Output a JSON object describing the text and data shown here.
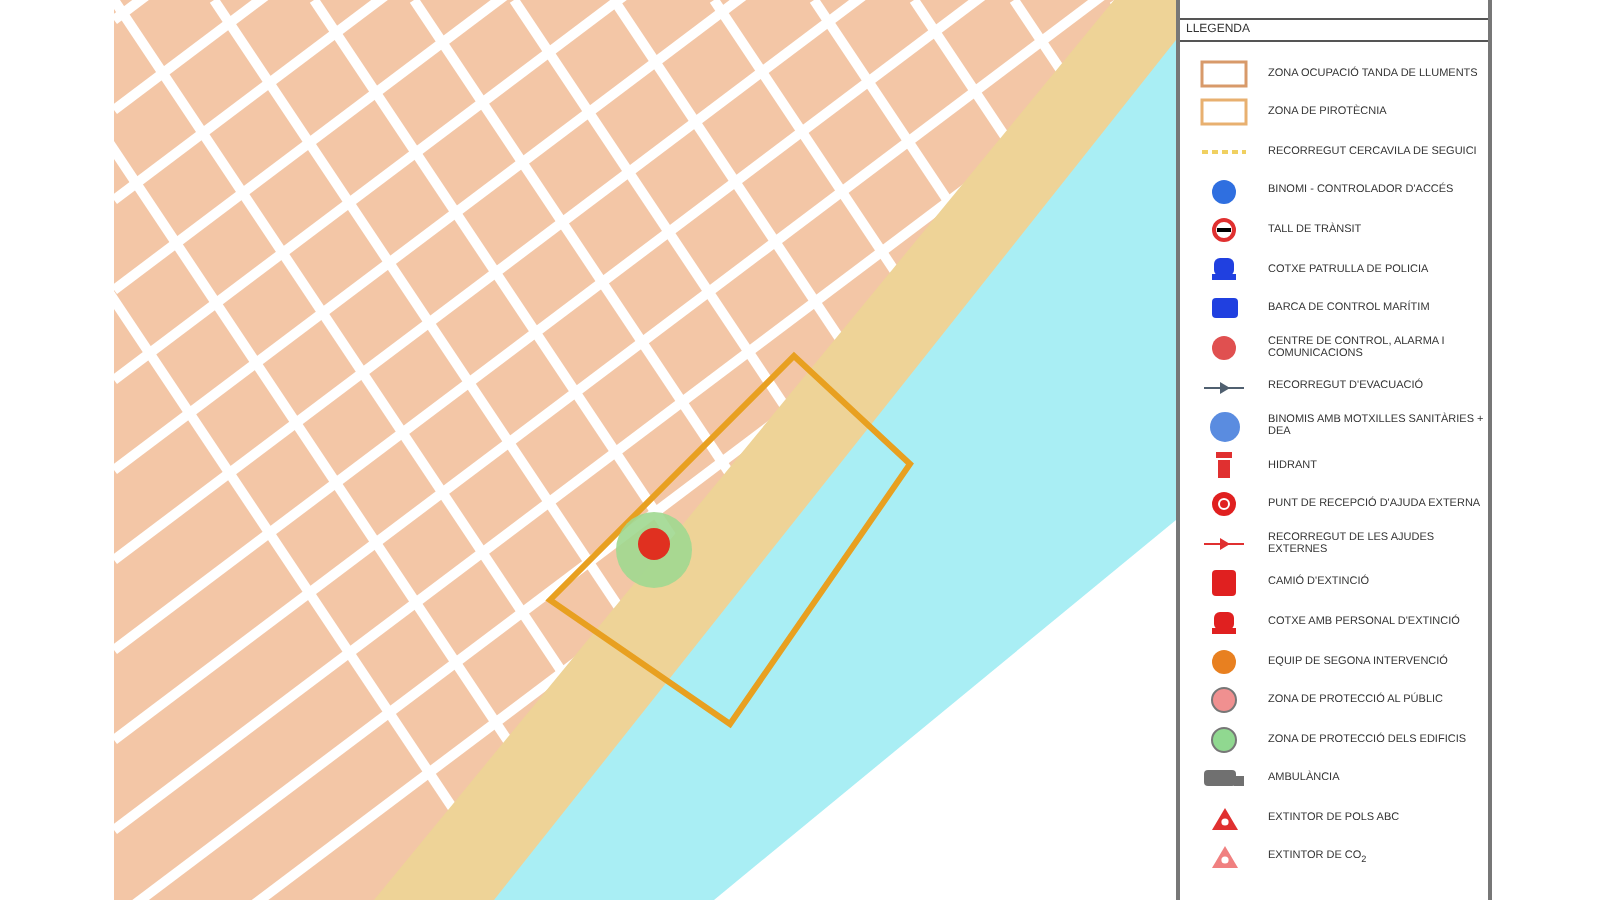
{
  "legend": {
    "title": "LLEGENDA",
    "items": [
      {
        "kind": "zone-rect",
        "color": "#d89a6a",
        "label": "ZONA OCUPACIÓ TANDA DE LLUMENTS"
      },
      {
        "kind": "zone-rect",
        "color": "#e8b070",
        "label": "ZONA DE PIROTÈCNIA"
      },
      {
        "kind": "dashed-line",
        "color": "#f0d060",
        "label": "RECORREGUT CERCAVILA DE SEGUICI"
      },
      {
        "kind": "circle",
        "color": "#2f6fe0",
        "label": "BINOMI - CONTROLADOR D'ACCÉS"
      },
      {
        "kind": "no-entry",
        "color": "#e03030",
        "label": "TALL DE TRÀNSIT"
      },
      {
        "kind": "car",
        "color": "#2040e0",
        "label": "COTXE PATRULLA DE POLICIA"
      },
      {
        "kind": "boat",
        "color": "#2040e0",
        "label": "BARCA DE CONTROL MARÍTIM"
      },
      {
        "kind": "circle",
        "color": "#e05050",
        "label": "CENTRE DE CONTROL, ALARMA I COMUNICACIONS"
      },
      {
        "kind": "arrow-line",
        "color": "#506070",
        "label": "RECORREGUT D'EVACUACIÓ"
      },
      {
        "kind": "big-circle",
        "color": "#5a8ce0",
        "label": "BINOMIS AMB MOTXILLES SANITÀRIES + DEA"
      },
      {
        "kind": "hydrant",
        "color": "#e03030",
        "label": "HIDRANT"
      },
      {
        "kind": "ring",
        "color": "#e02020",
        "label": "PUNT DE RECEPCIÓ D'AJUDA EXTERNA"
      },
      {
        "kind": "arrow-line",
        "color": "#e03030",
        "label": "RECORREGUT DE LES AJUDES EXTERNES"
      },
      {
        "kind": "truck",
        "color": "#e02020",
        "label": "CAMIÓ D'EXTINCIÓ"
      },
      {
        "kind": "car",
        "color": "#e02020",
        "label": "COTXE AMB PERSONAL D'EXTINCIÓ"
      },
      {
        "kind": "circle",
        "color": "#e88020",
        "label": "EQUIP DE SEGONA INTERVENCIÓ"
      },
      {
        "kind": "zone-circle",
        "color": "#f09090",
        "label": "ZONA DE PROTECCIÓ AL PÚBLIC"
      },
      {
        "kind": "zone-circle",
        "color": "#90d890",
        "label": "ZONA DE PROTECCIÓ DELS EDIFICIS"
      },
      {
        "kind": "ambulance",
        "color": "#707070",
        "label": "AMBULÀNCIA"
      },
      {
        "kind": "triangle",
        "color": "#e03030",
        "label": "EXTINTOR DE POLS ABC"
      },
      {
        "kind": "triangle",
        "color": "#f08080",
        "label": "EXTINTOR DE CO$_{2}$"
      }
    ]
  }
}
